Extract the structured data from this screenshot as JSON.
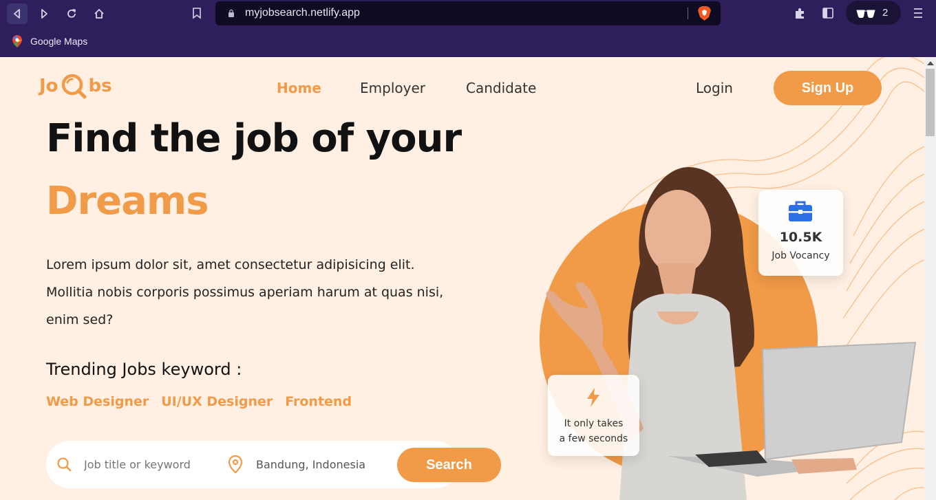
{
  "browser": {
    "url": "myjobsearch.netlify.app",
    "profile_count": "2",
    "bookmarks": [
      {
        "label": "Google Maps"
      }
    ]
  },
  "colors": {
    "accent": "#f19a47",
    "page_bg": "#fff0e3",
    "browser_bg": "#2e1e5c"
  },
  "header": {
    "logo_left": "Jo",
    "logo_right": "bs",
    "nav": [
      {
        "label": "Home"
      },
      {
        "label": "Employer"
      },
      {
        "label": "Candidate"
      }
    ],
    "login_label": "Login",
    "signup_label": "Sign Up"
  },
  "hero": {
    "title_line1": "Find the job of your",
    "title_line2": "Dreams",
    "description": "Lorem ipsum dolor sit, amet consectetur adipisicing elit. Mollitia nobis corporis possimus aperiam harum at quas nisi, enim sed?",
    "trending_title": "Trending Jobs keyword :",
    "trending": [
      "Web Designer",
      "UI/UX Designer",
      "Frontend"
    ]
  },
  "search": {
    "keyword_placeholder": "Job title or keyword",
    "location_value": "Bandung, Indonesia",
    "button_label": "Search"
  },
  "stats": {
    "vacancy_value": "10.5K",
    "vacancy_label": "Job Vocancy",
    "speed_label": "It only takes\na few seconds"
  }
}
